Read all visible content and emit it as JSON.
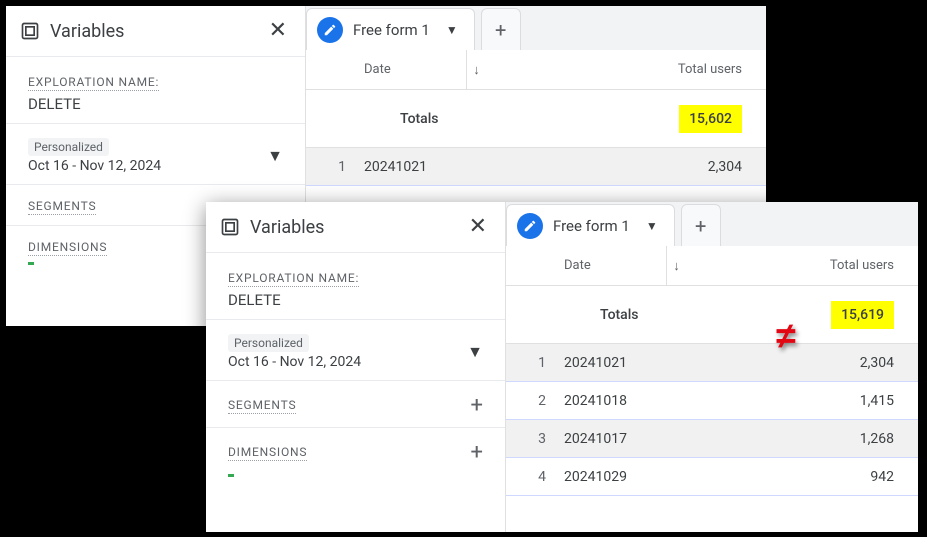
{
  "back": {
    "variables_title": "Variables",
    "exploration_label": "EXPLORATION NAME:",
    "exploration_name": "DELETE",
    "date_mode": "Personalized",
    "date_range": "Oct 16 - Nov 12, 2024",
    "segments_label": "SEGMENTS",
    "dimensions_label": "DIMENSIONS",
    "tab_label": "Free form 1",
    "col_date": "Date",
    "col_users": "Total users",
    "totals_label": "Totals",
    "totals_value": "15,602",
    "rows": [
      {
        "idx": "1",
        "date": "20241021",
        "users": "2,304"
      }
    ]
  },
  "front": {
    "variables_title": "Variables",
    "exploration_label": "EXPLORATION NAME:",
    "exploration_name": "DELETE",
    "date_mode": "Personalized",
    "date_range": "Oct 16 - Nov 12, 2024",
    "segments_label": "SEGMENTS",
    "dimensions_label": "DIMENSIONS",
    "tab_label": "Free form 1",
    "col_date": "Date",
    "col_users": "Total users",
    "totals_label": "Totals",
    "totals_value": "15,619",
    "rows": [
      {
        "idx": "1",
        "date": "20241021",
        "users": "2,304"
      },
      {
        "idx": "2",
        "date": "20241018",
        "users": "1,415"
      },
      {
        "idx": "3",
        "date": "20241017",
        "users": "1,268"
      },
      {
        "idx": "4",
        "date": "20241029",
        "users": "942"
      }
    ]
  },
  "neq_symbol": "≠"
}
